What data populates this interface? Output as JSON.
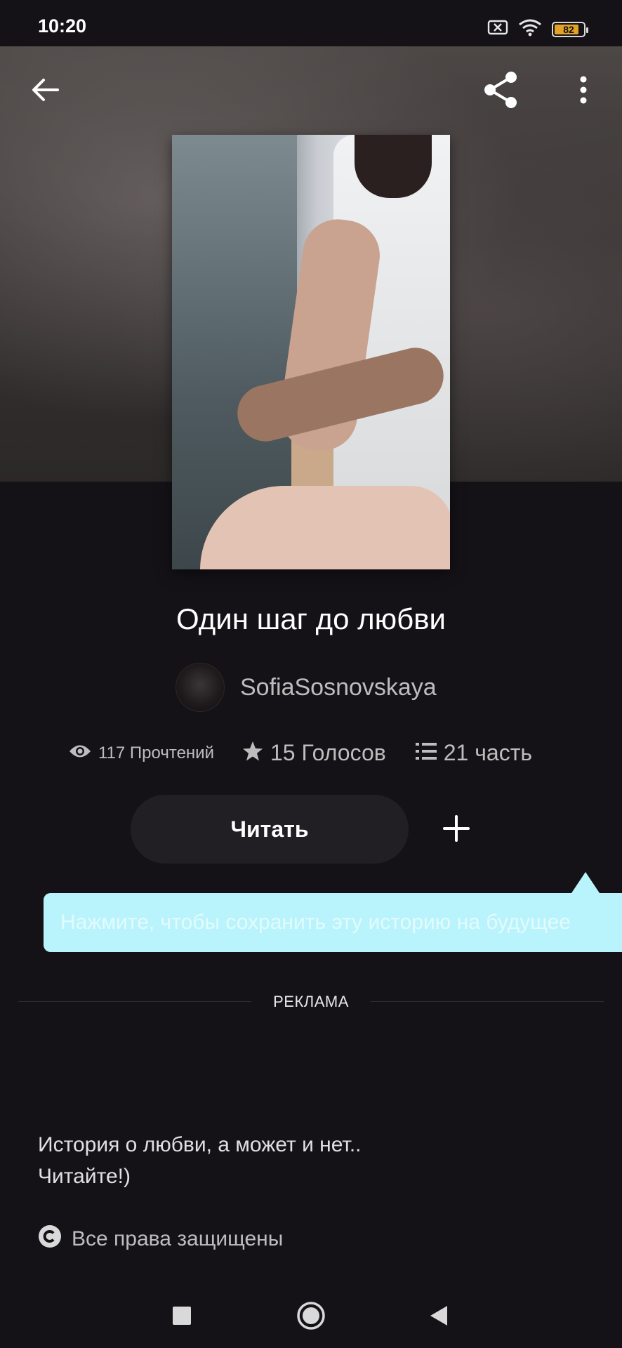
{
  "status_bar": {
    "time": "10:20",
    "battery_level": "82"
  },
  "icons": {
    "back": "arrow-left-icon",
    "share": "share-icon",
    "more": "more-vertical-icon",
    "reads": "eye-icon",
    "votes": "star-icon",
    "parts": "list-icon",
    "add": "plus-icon",
    "copyright": "copyright-icon"
  },
  "story": {
    "title": "Один шаг до любви",
    "author": "SofiaSosnovskaya",
    "stats": {
      "reads": "117 Прочтений",
      "votes": "15 Голосов",
      "parts": "21 часть"
    },
    "read_button": "Читать",
    "description_line1": "История о любви, а может и нет..",
    "description_line2": "Читайте!)",
    "copyright": "Все права защищены"
  },
  "tooltip": {
    "text": "Нажмите, чтобы сохранить эту историю на будущее"
  },
  "ad": {
    "label": "РЕКЛАМА"
  },
  "colors": {
    "background": "#141217",
    "tooltip_bg": "#b9f3fb",
    "button_bg": "#211f24",
    "muted_text": "#bdbdbd"
  }
}
